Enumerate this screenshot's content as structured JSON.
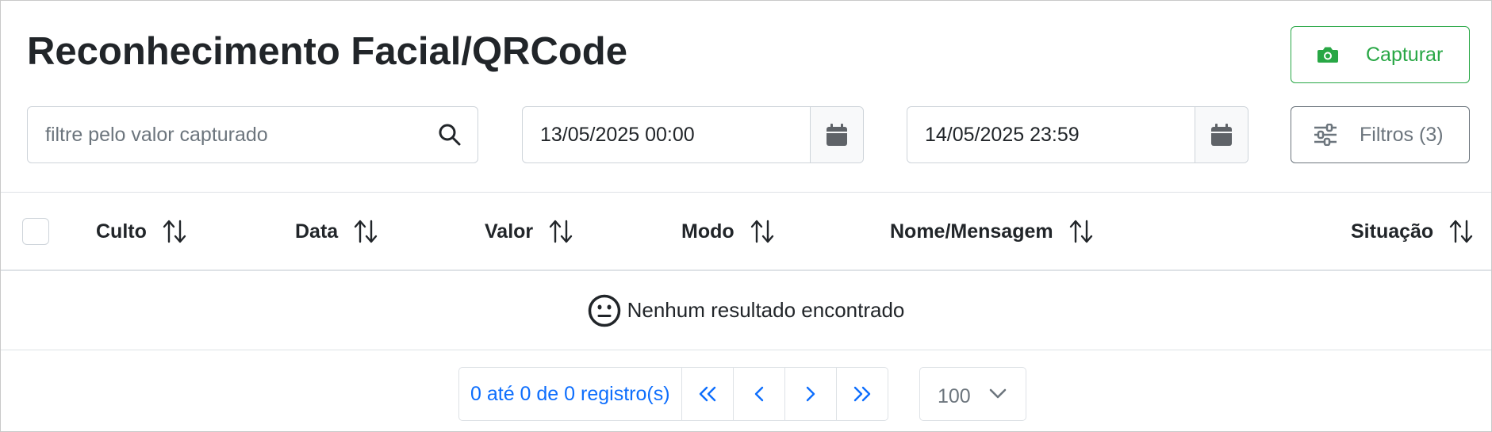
{
  "header": {
    "title": "Reconhecimento Facial/QRCode",
    "capture_label": "Capturar"
  },
  "filters": {
    "search_placeholder": "filtre pelo valor capturado",
    "search_value": "",
    "date_start": "13/05/2025 00:00",
    "date_end": "14/05/2025 23:59",
    "filters_label": "Filtros (3)"
  },
  "table": {
    "columns": [
      "Culto",
      "Data",
      "Valor",
      "Modo",
      "Nome/Mensagem",
      "Situação"
    ],
    "empty_message": "Nenhum resultado encontrado"
  },
  "pagination": {
    "info": "0 até 0 de 0 registro(s)",
    "page_size": "100"
  },
  "colors": {
    "success": "#28a745",
    "secondary": "#6c757d",
    "link": "#0d6efd"
  },
  "icons": [
    "camera-icon",
    "search-icon",
    "calendar-icon",
    "sliders-icon",
    "sort-icon",
    "neutral-face-icon",
    "double-chevron-left-icon",
    "chevron-left-icon",
    "chevron-right-icon",
    "double-chevron-right-icon",
    "chevron-down-icon"
  ]
}
